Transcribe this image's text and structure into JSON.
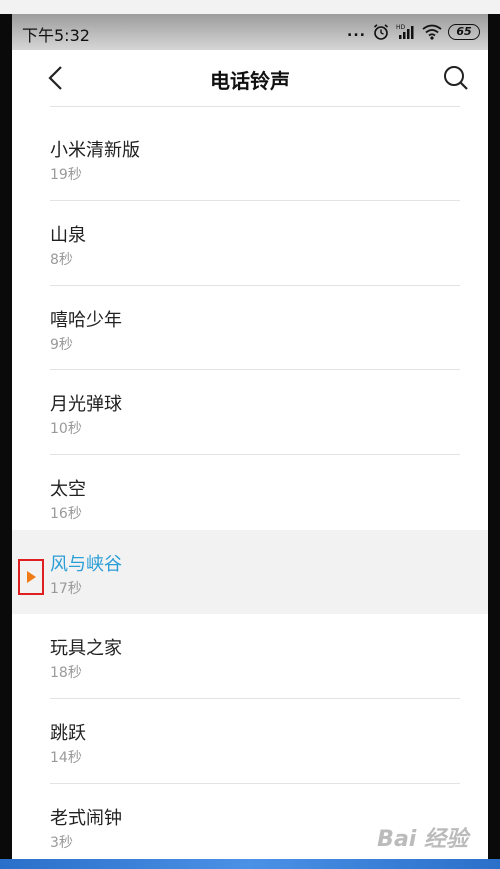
{
  "status_bar": {
    "time": "下午5:32",
    "dots": "...",
    "battery": "65"
  },
  "header": {
    "title": "电话铃声",
    "back_icon": "chevron-left-icon",
    "search_icon": "search-icon"
  },
  "ringtones": [
    {
      "name": "小米清新版",
      "duration": "19秒",
      "selected": false
    },
    {
      "name": "山泉",
      "duration": "8秒",
      "selected": false
    },
    {
      "name": "嘻哈少年",
      "duration": "9秒",
      "selected": false
    },
    {
      "name": "月光弹球",
      "duration": "10秒",
      "selected": false
    },
    {
      "name": "太空",
      "duration": "16秒",
      "selected": false
    },
    {
      "name": "风与峡谷",
      "duration": "17秒",
      "selected": true
    },
    {
      "name": "玩具之家",
      "duration": "18秒",
      "selected": false
    },
    {
      "name": "跳跃",
      "duration": "14秒",
      "selected": false
    },
    {
      "name": "老式闹钟",
      "duration": "3秒",
      "selected": false
    }
  ],
  "selected_color": "#2a9ed6",
  "play_icon_color": "#f07a14",
  "highlight_box_color": "#e02020",
  "watermark": "Bai 经验"
}
